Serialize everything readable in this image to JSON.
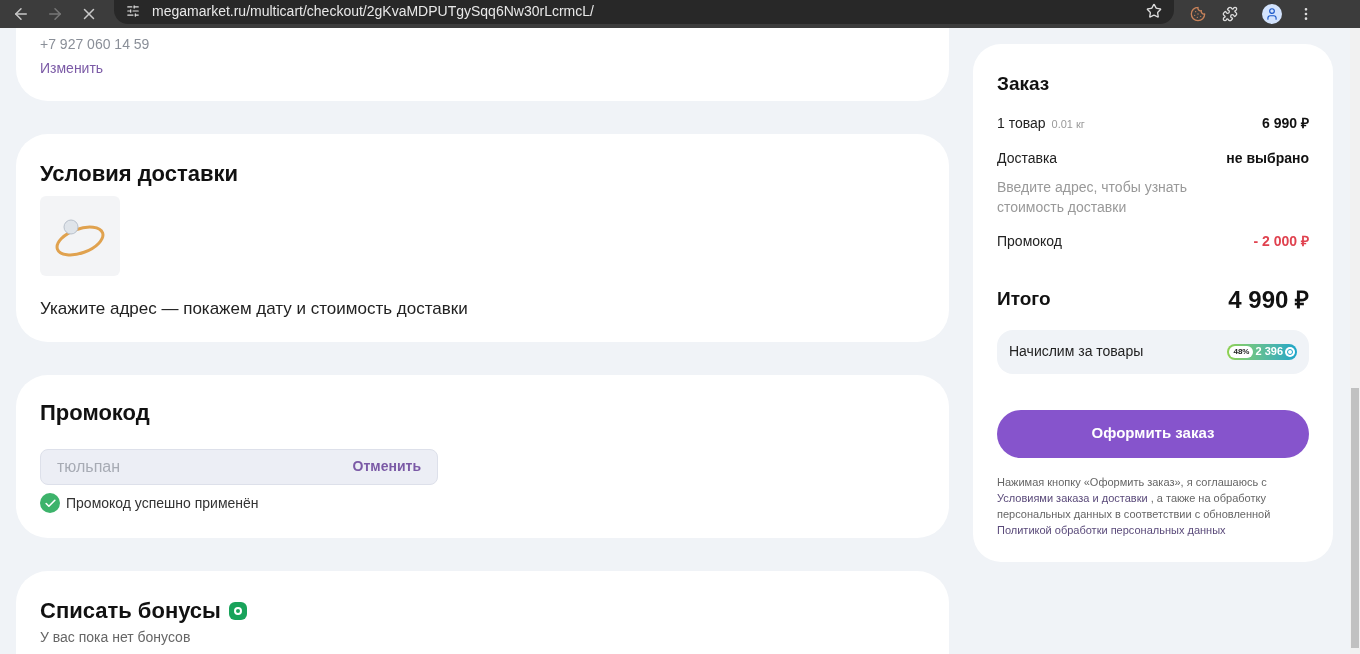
{
  "browser": {
    "url": "megamarket.ru/multicart/checkout/2gKvaMDPUTgySqq6Nw30rLcrmcL/"
  },
  "recipient": {
    "phone": "+7 927 060 14 59",
    "change_link": "Изменить"
  },
  "delivery": {
    "title": "Условия доставки",
    "hint": "Укажите адрес — покажем дату и стоимость доставки"
  },
  "promo": {
    "title": "Промокод",
    "value": "тюльпан",
    "cancel": "Отменить",
    "applied": true,
    "message": "Промокод успешно применён"
  },
  "bonuses": {
    "title": "Списать бонусы",
    "message": "У вас пока нет бонусов"
  },
  "order": {
    "title": "Заказ",
    "rows": [
      {
        "label": "1 товар",
        "note": "0.01 кг",
        "value": "6 990 ₽",
        "negative": false
      },
      {
        "label": "Доставка",
        "value": "не выбрано",
        "negative": false,
        "hint": "Введите адрес, чтобы узнать стоимость доставки"
      },
      {
        "label": "Промокод",
        "value": "- 2 000 ₽",
        "negative": true
      }
    ],
    "total_label": "Итого",
    "total_value": "4 990 ₽",
    "accrual": {
      "label": "Начислим за товары",
      "percent": "48%",
      "amount": "2 396"
    },
    "submit": "Оформить заказ",
    "legal": [
      {
        "kind": "text",
        "text": "Нажимая кнопку «Оформить заказ», я соглашаюсь с"
      },
      {
        "kind": "link",
        "text": "Условиями заказа и доставки"
      },
      {
        "kind": "text",
        "text": ", а также на обработку персональных данных в соответствии с обновленной"
      },
      {
        "kind": "link",
        "text": "Политикой обработки персональных данных"
      }
    ]
  }
}
